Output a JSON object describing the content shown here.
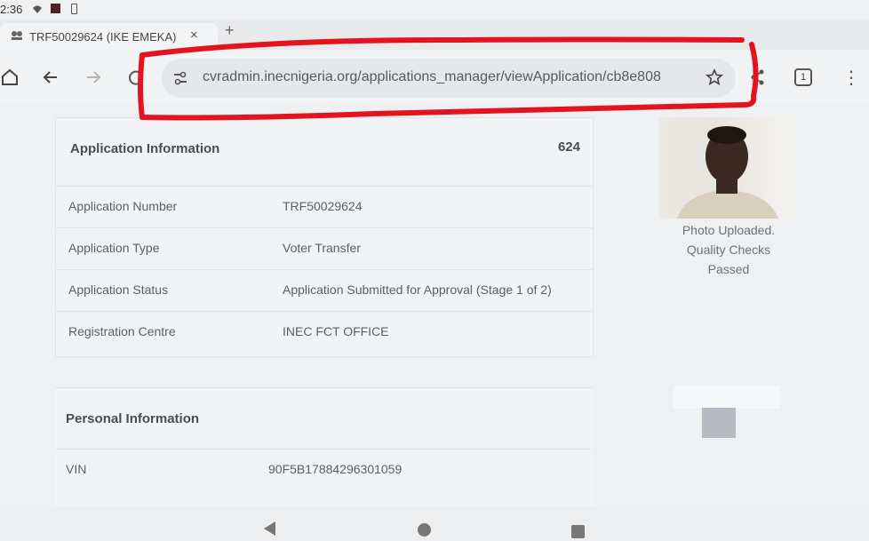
{
  "status_bar": {
    "time": "2:36"
  },
  "tab": {
    "title": "TRF50029624 (IKE EMEKA)",
    "close_glyph": "×"
  },
  "new_tab_glyph": "+",
  "toolbar": {
    "url": "cvradmin.inecnigeria.org/applications_manager/viewApplication/cb8e808",
    "tab_count": "1",
    "menu_glyph": "⋮"
  },
  "annotation_color": "#e4141e",
  "application": {
    "heading": "Application Information",
    "number_badge": "624",
    "rows": [
      {
        "label": "Application Number",
        "value": "TRF50029624"
      },
      {
        "label": "Application Type",
        "value": "Voter Transfer"
      },
      {
        "label": "Application Status",
        "value": "Application Submitted for Approval (Stage 1 of 2)"
      },
      {
        "label": "Registration Centre",
        "value": "INEC FCT OFFICE"
      }
    ]
  },
  "photo": {
    "caption": [
      "Photo Uploaded.",
      "Quality Checks",
      "Passed"
    ]
  },
  "personal": {
    "heading": "Personal Information",
    "rows": [
      {
        "label": "VIN",
        "value": "90F5B17884296301059"
      }
    ]
  }
}
